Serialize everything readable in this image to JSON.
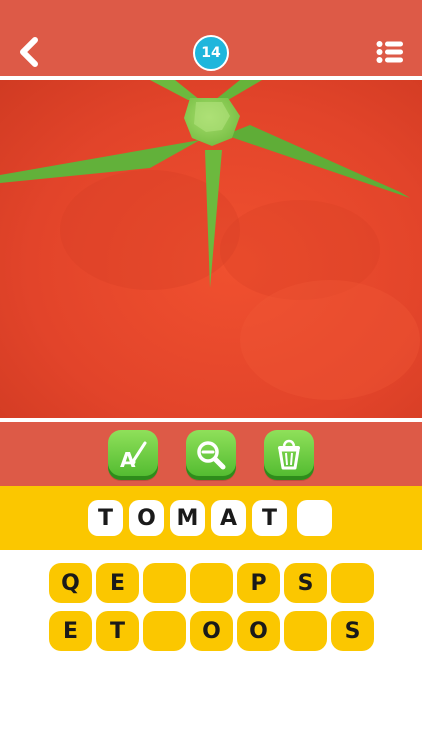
{
  "header": {
    "level": "14",
    "back_icon": "chevron-left-icon",
    "menu_icon": "list-menu-icon",
    "background_color": "#dd5a47",
    "badge_color": "#1fb6dc"
  },
  "tools": [
    {
      "name": "reveal-letter",
      "icon": "letter-a-brush-icon"
    },
    {
      "name": "zoom-out",
      "icon": "magnifier-minus-icon"
    },
    {
      "name": "remove-letters",
      "icon": "trash-bin-icon"
    }
  ],
  "answer": {
    "slots": [
      "T",
      "O",
      "M",
      "A",
      "T",
      ""
    ]
  },
  "letters": {
    "row1": [
      "Q",
      "E",
      "",
      "",
      "P",
      "S",
      ""
    ],
    "row2": [
      "E",
      "T",
      "",
      "O",
      "O",
      "",
      "S"
    ]
  },
  "colors": {
    "tile": "#fbc700",
    "tool_green": "#4fb92e",
    "tomato": "#e2442a"
  }
}
